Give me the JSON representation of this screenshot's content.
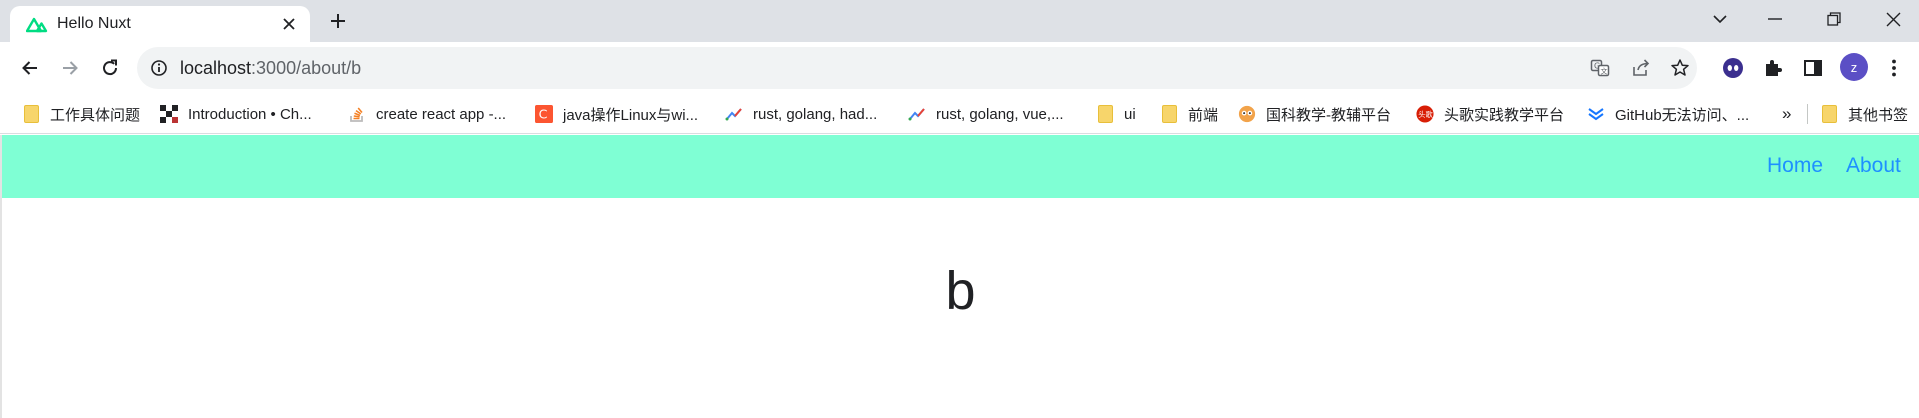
{
  "tab": {
    "title": "Hello Nuxt"
  },
  "toolbar": {
    "url_host": "localhost",
    "url_rest": ":3000/about/b",
    "avatar_letter": "z"
  },
  "bookmarks": [
    {
      "label": "工作具体问题",
      "icon": "folder-icon"
    },
    {
      "label": "Introduction • Ch...",
      "icon": "site-favicon"
    },
    {
      "label": "create react app -...",
      "icon": "stackoverflow-icon"
    },
    {
      "label": "java操作Linux与wi...",
      "icon": "csdn-icon"
    },
    {
      "label": "rust, golang, had...",
      "icon": "trend-icon"
    },
    {
      "label": "rust, golang, vue,...",
      "icon": "trend-icon"
    },
    {
      "label": "ui",
      "icon": "folder-icon"
    },
    {
      "label": "前端",
      "icon": "folder-icon"
    },
    {
      "label": "国科教学-教辅平台",
      "icon": "site-favicon"
    },
    {
      "label": "头歌实践教学平台",
      "icon": "site-favicon"
    },
    {
      "label": "GitHub无法访问、...",
      "icon": "site-favicon"
    }
  ],
  "bookmarks_overflow": "»",
  "other_bookmarks": "其他书签",
  "site": {
    "nav": [
      {
        "label": "Home"
      },
      {
        "label": "About"
      }
    ],
    "heading": "b"
  },
  "colors": {
    "header_bg": "#7fffd4",
    "nav_link": "#1e90ff",
    "tabstrip_bg": "#dee1e6",
    "avatar_bg": "#5b4fc5"
  }
}
